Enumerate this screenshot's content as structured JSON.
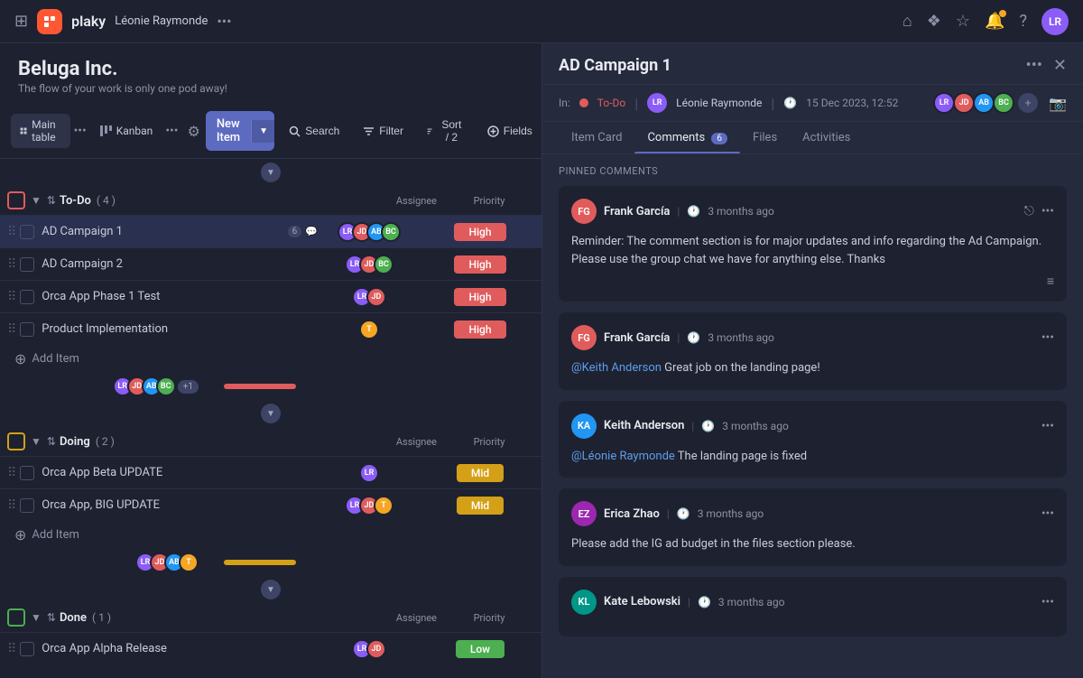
{
  "topnav": {
    "logo_letter": "p",
    "logo_text": "plaky",
    "user_name": "Léonie Raymonde",
    "more_label": "•••"
  },
  "project": {
    "name": "Beluga Inc.",
    "subtitle": "The flow of your work is only one pod away!"
  },
  "toolbar": {
    "view_main": "Main table",
    "view_kanban": "Kanban",
    "new_item": "New Item",
    "search": "Search",
    "filter": "Filter",
    "sort": "Sort / 2",
    "fields": "Fields"
  },
  "groups": [
    {
      "name": "To-Do",
      "color": "#e05c5c",
      "count": 4,
      "items": [
        {
          "name": "AD Campaign 1",
          "badge": "6",
          "assignees": [
            "lr",
            "jd",
            "ab",
            "bc"
          ],
          "priority": "High",
          "priority_class": "high",
          "selected": true
        },
        {
          "name": "AD Campaign 2",
          "assignees": [
            "lr",
            "jd",
            "bc"
          ],
          "priority": "High",
          "priority_class": "high"
        },
        {
          "name": "Orca App Phase 1 Test",
          "assignees": [
            "lr",
            "jd"
          ],
          "priority": "High",
          "priority_class": "high"
        },
        {
          "name": "Product Implementation",
          "assignees": [
            "t"
          ],
          "priority": "High",
          "priority_class": "high"
        }
      ],
      "summary_more": "+1"
    },
    {
      "name": "Doing",
      "color": "#d4a017",
      "count": 2,
      "items": [
        {
          "name": "Orca App Beta UPDATE",
          "assignees": [
            "lr"
          ],
          "priority": "Mid",
          "priority_class": "mid"
        },
        {
          "name": "Orca App, BIG UPDATE",
          "assignees": [
            "lr",
            "jd",
            "t"
          ],
          "priority": "Mid",
          "priority_class": "mid"
        }
      ]
    },
    {
      "name": "Done",
      "color": "#4caf50",
      "count": 1,
      "items": [
        {
          "name": "Orca App Alpha Release",
          "assignees": [
            "lr",
            "jd"
          ],
          "priority": "Low",
          "priority_class": "low"
        }
      ]
    }
  ],
  "detail_panel": {
    "title": "AD Campaign 1",
    "status": "To-Do",
    "user": "Léonie Raymonde",
    "timestamp": "15 Dec 2023, 12:52",
    "tabs": [
      {
        "label": "Item Card",
        "active": false
      },
      {
        "label": "Comments",
        "badge": "6",
        "active": true
      },
      {
        "label": "Files",
        "active": false
      },
      {
        "label": "Activities",
        "active": false
      }
    ],
    "pinned_label": "Pinned Comments",
    "comments": [
      {
        "author": "Frank García",
        "time": "3 months ago",
        "avatar_bg": "#e05c5c",
        "avatar_initials": "FG",
        "body": "Reminder: The comment section is for major updates and info regarding the Ad Campaign. Please use the group chat we have for anything else. Thanks",
        "pinned": true,
        "has_format": true
      },
      {
        "author": "Frank García",
        "time": "3 months ago",
        "avatar_bg": "#e05c5c",
        "avatar_initials": "FG",
        "body": "@Keith Anderson  Great job on the landing page!",
        "mention": "@Keith Anderson"
      },
      {
        "author": "Keith Anderson",
        "time": "3 months ago",
        "avatar_bg": "#2196f3",
        "avatar_initials": "KA",
        "body": "@Léonie Raymonde  The landing page is fixed",
        "mention": "@Léonie Raymonde"
      },
      {
        "author": "Erica Zhao",
        "time": "3 months ago",
        "avatar_bg": "#9c27b0",
        "avatar_initials": "EZ",
        "body": "Please add the IG ad budget in the files section please."
      },
      {
        "author": "Kate Lebowski",
        "time": "3 months ago",
        "avatar_bg": "#009688",
        "avatar_initials": "KL",
        "body": ""
      }
    ]
  },
  "avatar_colors": {
    "lr": "#8b5cf6",
    "jd": "#e05c5c",
    "ab": "#2196f3",
    "bc": "#4caf50",
    "t": "#f5a623"
  },
  "avatar_initials": {
    "lr": "LR",
    "jd": "JD",
    "ab": "AB",
    "bc": "BC",
    "t": "T"
  }
}
